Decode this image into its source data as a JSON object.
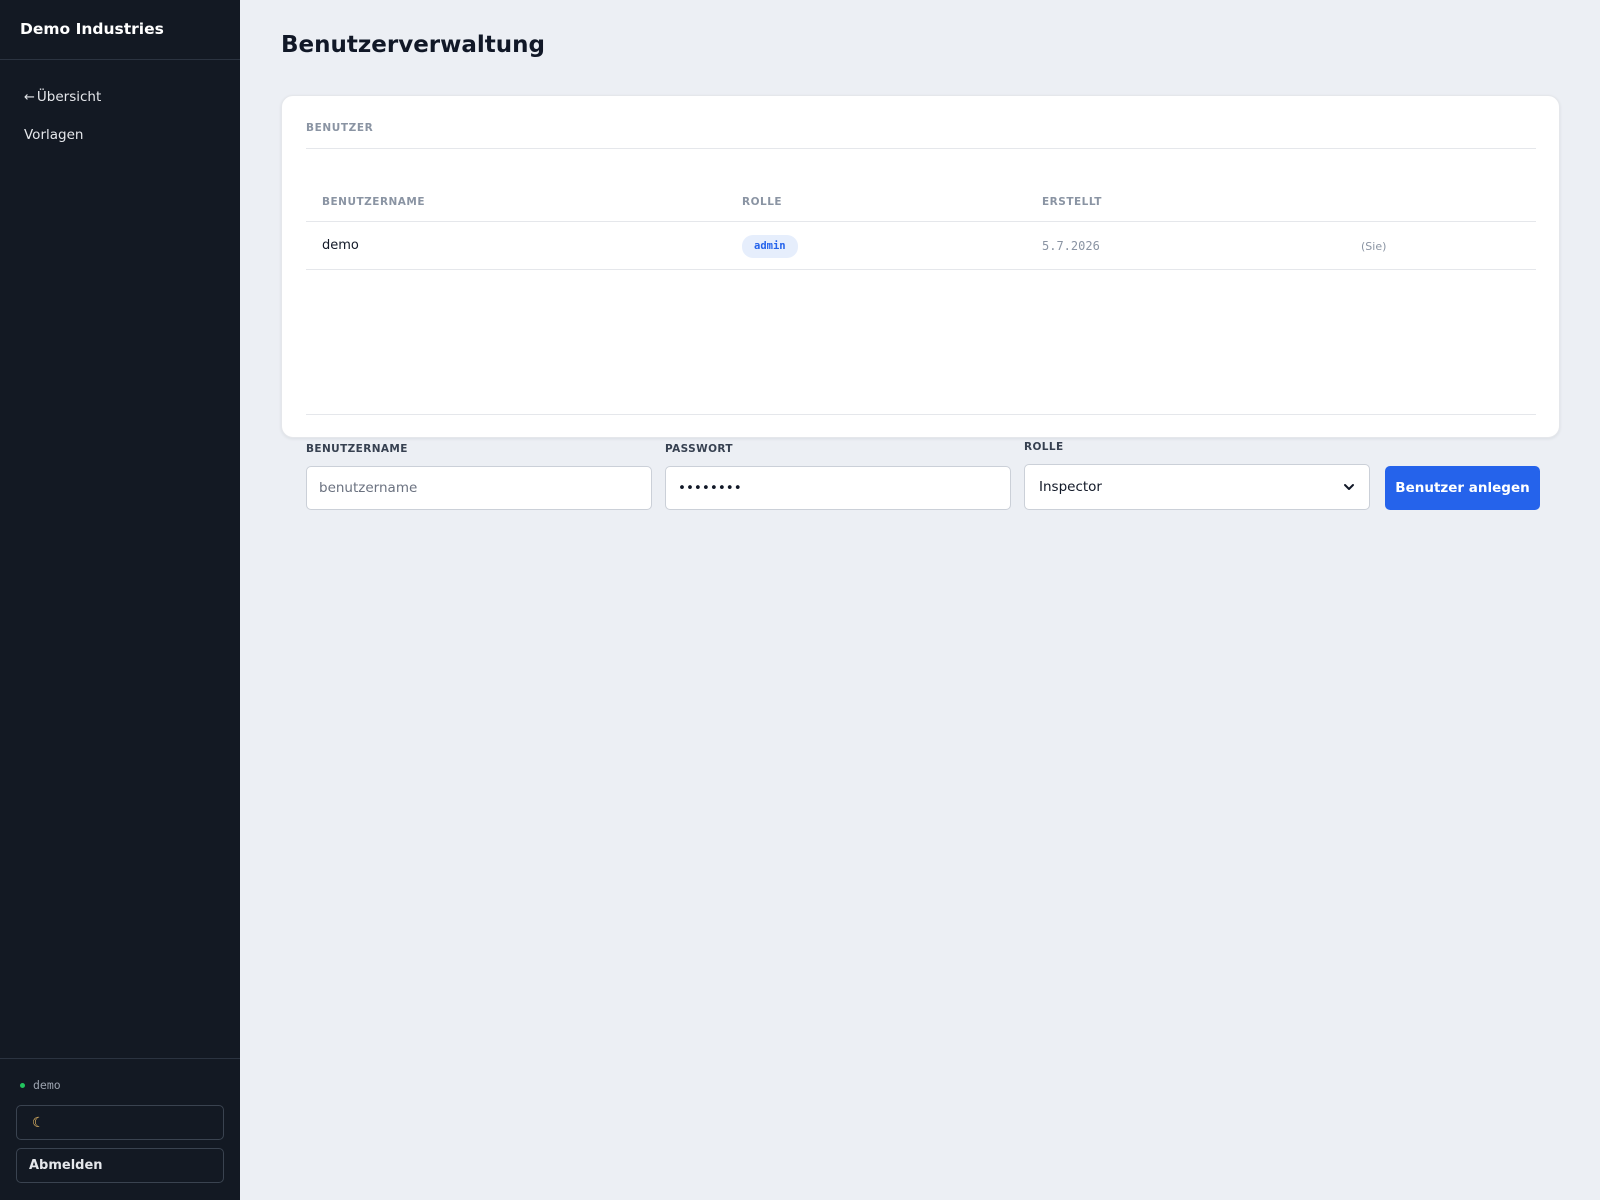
{
  "sidebar": {
    "brand": "Demo Industries",
    "nav": [
      {
        "arrow": "←",
        "label": "Übersicht"
      },
      {
        "label": "Vorlagen"
      }
    ],
    "footer": {
      "username": "demo",
      "theme_icon": "moon-icon",
      "logout_label": "Abmelden"
    }
  },
  "main": {
    "title": "Benutzerverwaltung",
    "card": {
      "heading": "BENUTZER",
      "table": {
        "columns": [
          "BENUTZERNAME",
          "ROLLE",
          "ERSTELLT"
        ],
        "rows": [
          {
            "username": "demo",
            "role": "admin",
            "created": "5.7.2026",
            "note": "(Sie)"
          }
        ]
      },
      "form": {
        "username_label": "BENUTZERNAME",
        "username_placeholder": "benutzername",
        "password_label": "PASSWORT",
        "password_value": "••••••••",
        "role_label": "ROLLE",
        "role_selected": "Inspector",
        "submit_label": "Benutzer anlegen"
      }
    }
  },
  "colors": {
    "sidebar_bg": "#131923",
    "page_bg": "#eceff4",
    "accent": "#2563eb",
    "badge_bg": "#e6eefc",
    "status_online": "#22c55e"
  }
}
